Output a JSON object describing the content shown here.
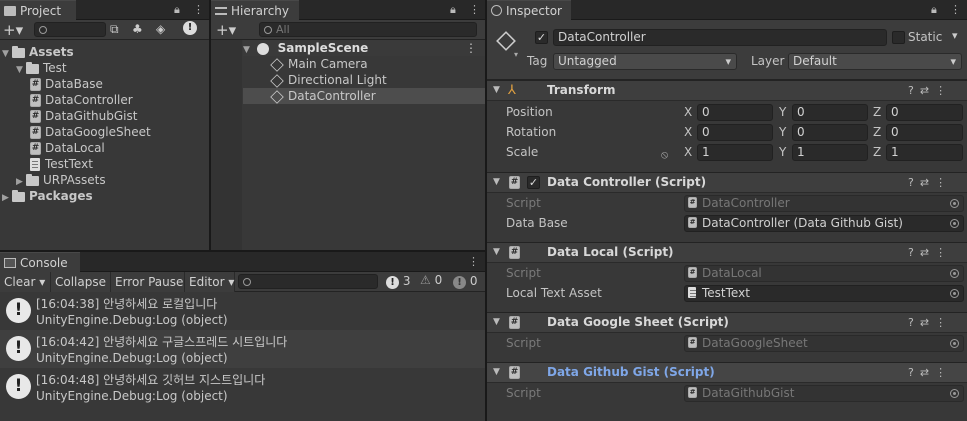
{
  "project": {
    "tab": "Project",
    "tree": [
      {
        "label": "Assets",
        "kind": "folder",
        "depth": 0,
        "bold": true,
        "expanded": true
      },
      {
        "label": "Test",
        "kind": "folder",
        "depth": 1,
        "expanded": true
      },
      {
        "label": "DataBase",
        "kind": "script",
        "depth": 2
      },
      {
        "label": "DataController",
        "kind": "script",
        "depth": 2
      },
      {
        "label": "DataGithubGist",
        "kind": "script",
        "depth": 2
      },
      {
        "label": "DataGoogleSheet",
        "kind": "script",
        "depth": 2
      },
      {
        "label": "DataLocal",
        "kind": "script",
        "depth": 2
      },
      {
        "label": "TestText",
        "kind": "text",
        "depth": 2
      },
      {
        "label": "URPAssets",
        "kind": "folder",
        "depth": 1,
        "expanded": false
      },
      {
        "label": "Packages",
        "kind": "folder",
        "depth": 0,
        "bold": true,
        "expanded": false
      }
    ],
    "hidden_count_badge": "18"
  },
  "hierarchy": {
    "tab": "Hierarchy",
    "search_placeholder": "All",
    "scene": "SampleScene",
    "objects": [
      "Main Camera",
      "Directional Light",
      "DataController"
    ],
    "selected": "DataController"
  },
  "console": {
    "tab": "Console",
    "buttons": {
      "clear": "Clear",
      "collapse": "Collapse",
      "error_pause": "Error Pause",
      "editor": "Editor"
    },
    "counts": {
      "log": "3",
      "warn": "0",
      "error": "0"
    },
    "logs": [
      {
        "line1": "[16:04:38] 안녕하세요 로컬입니다",
        "line2": "UnityEngine.Debug:Log (object)"
      },
      {
        "line1": "[16:04:42] 안녕하세요 구글스프레드 시트입니다",
        "line2": "UnityEngine.Debug:Log (object)"
      },
      {
        "line1": "[16:04:48] 안녕하세요 깃허브 지스트입니다",
        "line2": "UnityEngine.Debug:Log (object)"
      }
    ]
  },
  "inspector": {
    "tab": "Inspector",
    "object_name": "DataController",
    "static_label": "Static",
    "tag_label": "Tag",
    "tag_value": "Untagged",
    "layer_label": "Layer",
    "layer_value": "Default",
    "transform": {
      "title": "Transform",
      "rows": [
        {
          "label": "Position",
          "x": "0",
          "y": "0",
          "z": "0"
        },
        {
          "label": "Rotation",
          "x": "0",
          "y": "0",
          "z": "0"
        },
        {
          "label": "Scale",
          "x": "1",
          "y": "1",
          "z": "1"
        }
      ],
      "axis": {
        "x": "X",
        "y": "Y",
        "z": "Z"
      }
    },
    "components": [
      {
        "title": "Data Controller (Script)",
        "highlight": false,
        "checkbox": true,
        "fields": [
          {
            "label": "Script",
            "value": "DataController",
            "disabled": true,
            "icon": "script"
          },
          {
            "label": "Data Base",
            "value": "DataController (Data Github Gist)",
            "disabled": false,
            "icon": "script"
          }
        ]
      },
      {
        "title": "Data Local (Script)",
        "highlight": false,
        "checkbox": false,
        "fields": [
          {
            "label": "Script",
            "value": "DataLocal",
            "disabled": true,
            "icon": "script"
          },
          {
            "label": "Local Text Asset",
            "value": "TestText",
            "disabled": false,
            "icon": "text"
          }
        ]
      },
      {
        "title": "Data Google Sheet (Script)",
        "highlight": false,
        "checkbox": false,
        "fields": [
          {
            "label": "Script",
            "value": "DataGoogleSheet",
            "disabled": true,
            "icon": "script"
          }
        ]
      },
      {
        "title": "Data Github Gist (Script)",
        "highlight": true,
        "checkbox": false,
        "fields": [
          {
            "label": "Script",
            "value": "DataGithubGist",
            "disabled": true,
            "icon": "script"
          }
        ]
      }
    ]
  },
  "colors": {
    "accent_title": "#7fa7e8",
    "selection": "#4d4d4d"
  }
}
